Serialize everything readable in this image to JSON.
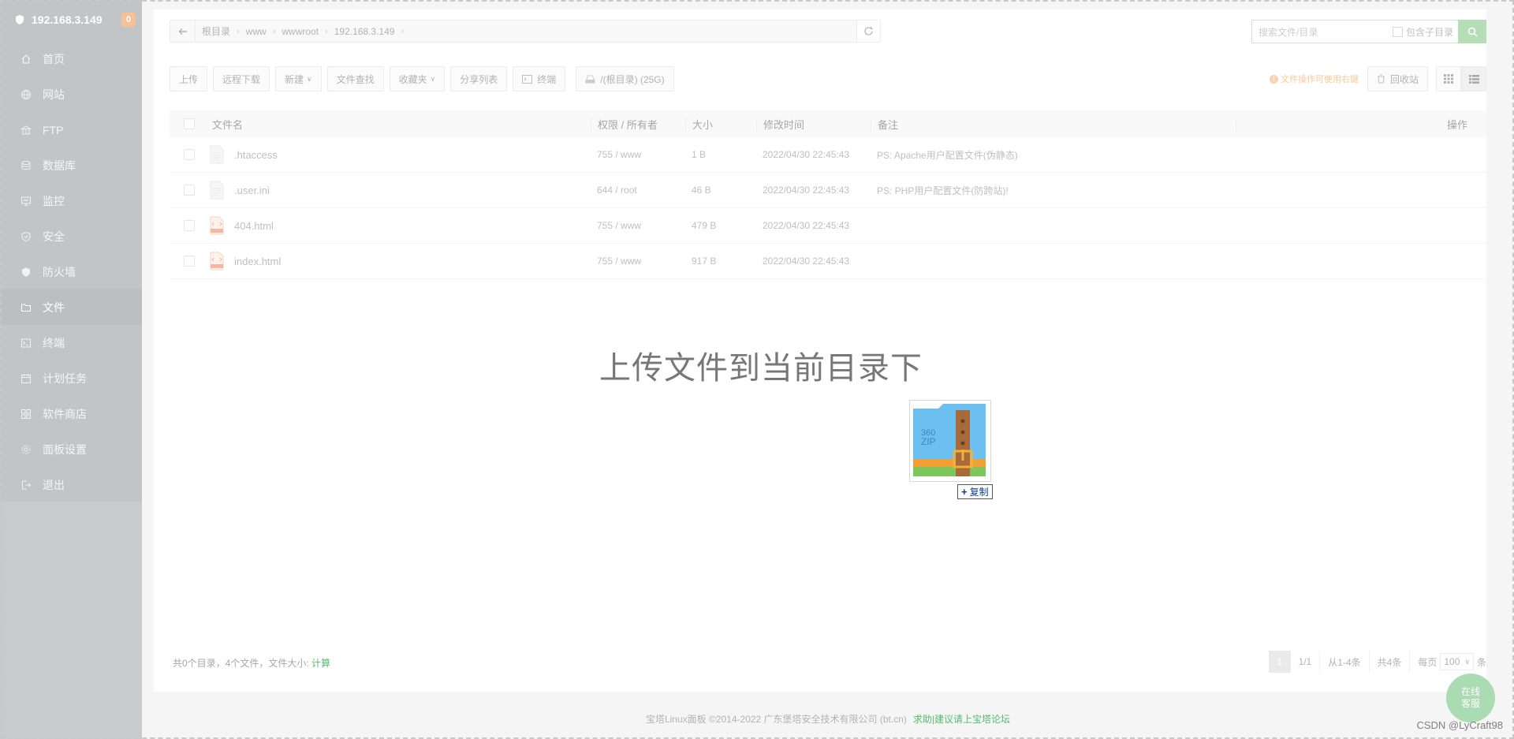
{
  "sidebar": {
    "host": "192.168.3.149",
    "badge": "0",
    "items": [
      {
        "label": "首页",
        "icon": "home-icon"
      },
      {
        "label": "网站",
        "icon": "globe-icon"
      },
      {
        "label": "FTP",
        "icon": "ftp-icon"
      },
      {
        "label": "数据库",
        "icon": "database-icon"
      },
      {
        "label": "监控",
        "icon": "monitor-icon"
      },
      {
        "label": "安全",
        "icon": "shield-icon"
      },
      {
        "label": "防火墙",
        "icon": "firewall-icon"
      },
      {
        "label": "文件",
        "icon": "folder-icon"
      },
      {
        "label": "终端",
        "icon": "terminal-icon"
      },
      {
        "label": "计划任务",
        "icon": "calendar-icon"
      },
      {
        "label": "软件商店",
        "icon": "apps-icon"
      },
      {
        "label": "面板设置",
        "icon": "gear-icon"
      },
      {
        "label": "退出",
        "icon": "logout-icon"
      }
    ],
    "active_index": 7
  },
  "path": {
    "crumbs": [
      "根目录",
      "www",
      "wwwroot",
      "192.168.3.149"
    ]
  },
  "search": {
    "placeholder": "搜索文件/目录",
    "include_sub": "包含子目录"
  },
  "toolbar": {
    "upload": "上传",
    "remote_download": "远程下载",
    "new": "新建",
    "find": "文件查找",
    "favorites": "收藏夹",
    "share_list": "分享列表",
    "terminal": "终端",
    "disk": "/(根目录) (25G)",
    "tip": "文件操作可使用右键",
    "recycle": "回收站"
  },
  "table": {
    "headers": {
      "name": "文件名",
      "perm": "权限 / 所有者",
      "size": "大小",
      "time": "修改时间",
      "note": "备注",
      "op": "操作"
    },
    "rows": [
      {
        "name": ".htaccess",
        "perm": "755 / www",
        "size": "1 B",
        "time": "2022/04/30 22:45:43",
        "note": "PS: Apache用户配置文件(伪静态)",
        "type": "text"
      },
      {
        "name": ".user.ini",
        "perm": "644 / root",
        "size": "46 B",
        "time": "2022/04/30 22:45:43",
        "note": "PS: PHP用户配置文件(防跨站)!",
        "type": "text"
      },
      {
        "name": "404.html",
        "perm": "755 / www",
        "size": "479 B",
        "time": "2022/04/30 22:45:43",
        "note": "",
        "type": "html"
      },
      {
        "name": "index.html",
        "perm": "755 / www",
        "size": "917 B",
        "time": "2022/04/30 22:45:43",
        "note": "",
        "type": "html"
      }
    ]
  },
  "drop": {
    "message": "上传文件到当前目录下",
    "copy_label": "复制",
    "zip_text": "360 ZIP"
  },
  "status": {
    "summary": "共0个目录，4个文件，文件大小: ",
    "calc": "计算"
  },
  "pager": {
    "current": "1",
    "pages": "1/1",
    "range": "从1-4条",
    "total": "共4条",
    "per_page_label": "每页",
    "per_page": "100",
    "unit": "条"
  },
  "footer": {
    "copyright": "宝塔Linux面板 ©2014-2022 广东堡塔安全技术有限公司 (bt.cn)",
    "help": "求助|建议请上宝塔论坛"
  },
  "service": {
    "line1": "在线",
    "line2": "客服"
  },
  "watermark": "CSDN @LyCraft98"
}
